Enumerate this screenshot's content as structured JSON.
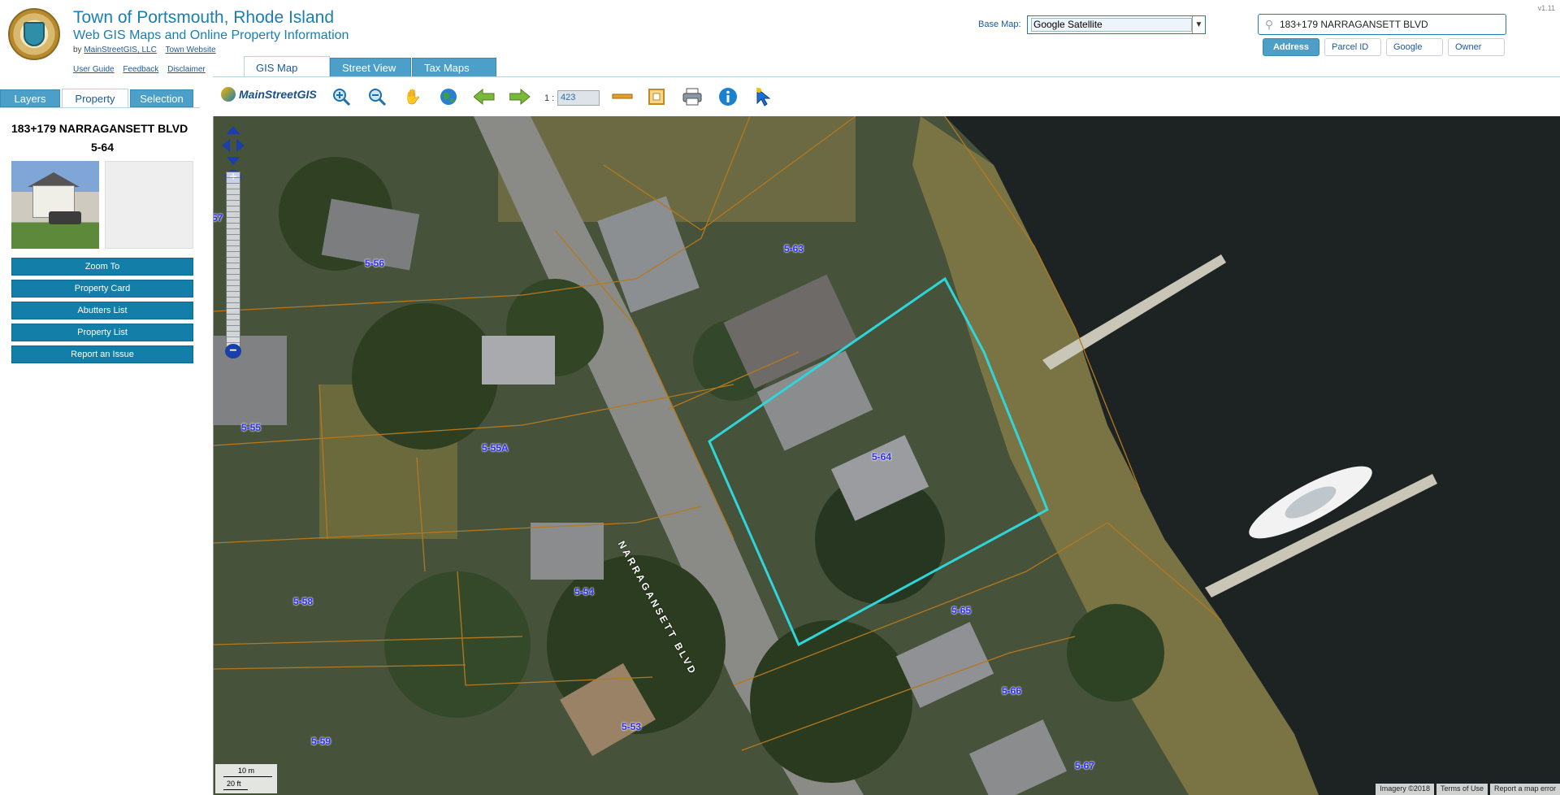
{
  "header": {
    "title": "Town of Portsmouth, Rhode Island",
    "subtitle": "Web GIS Maps and Online Property Information",
    "by_prefix": "by",
    "by_company": "MainStreetGIS, LLC",
    "town_website": "Town Website",
    "help_links": [
      "User Guide",
      "Feedback",
      "Disclaimer"
    ],
    "version": "v1.11"
  },
  "basemap": {
    "label": "Base Map:",
    "value": "Google Satellite"
  },
  "search": {
    "value": "183+179 NARRAGANSETT BLVD",
    "modes": [
      "Address",
      "Parcel ID",
      "Google",
      "Owner"
    ],
    "active_mode": "Address"
  },
  "top_tabs": [
    "GIS Map",
    "Street View",
    "Tax Maps"
  ],
  "panel": {
    "tabs": [
      "Layers",
      "Property",
      "Selection"
    ],
    "active_tab": "Property",
    "address": "183+179 NARRAGANSETT BLVD",
    "parcel_id": "5-64",
    "buttons": [
      "Zoom To",
      "Property Card",
      "Abutters List",
      "Property List",
      "Report an Issue"
    ]
  },
  "toolbar": {
    "logo": "MainStreetGIS",
    "scale_prefix": "1 :",
    "scale_value": "423",
    "tools": [
      "zoom-in-icon",
      "zoom-out-icon",
      "pan-hand-icon",
      "globe-icon",
      "back-arrow-icon",
      "forward-arrow-icon",
      "measure-icon",
      "select-box-icon",
      "print-icon",
      "info-icon",
      "identify-pointer-icon"
    ]
  },
  "map": {
    "street_label": "NARRAGANSETT BLVD",
    "lot_labels": [
      "5-56",
      "5-63",
      "5-55",
      "5-55A",
      "5-64",
      "5-58",
      "5-54",
      "5-65",
      "5-66",
      "5-59",
      "5-53",
      "5-67",
      "57"
    ],
    "selected_parcel": "5-64",
    "scalebar": {
      "metric": "10 m",
      "imperial": "20 ft"
    },
    "attribution": [
      "Imagery ©2018",
      "Terms of Use",
      "Report a map error"
    ],
    "colors": {
      "selection": "#2fd5d8",
      "parcel_lines": "#b5781f",
      "label": "#2a2cff"
    }
  }
}
